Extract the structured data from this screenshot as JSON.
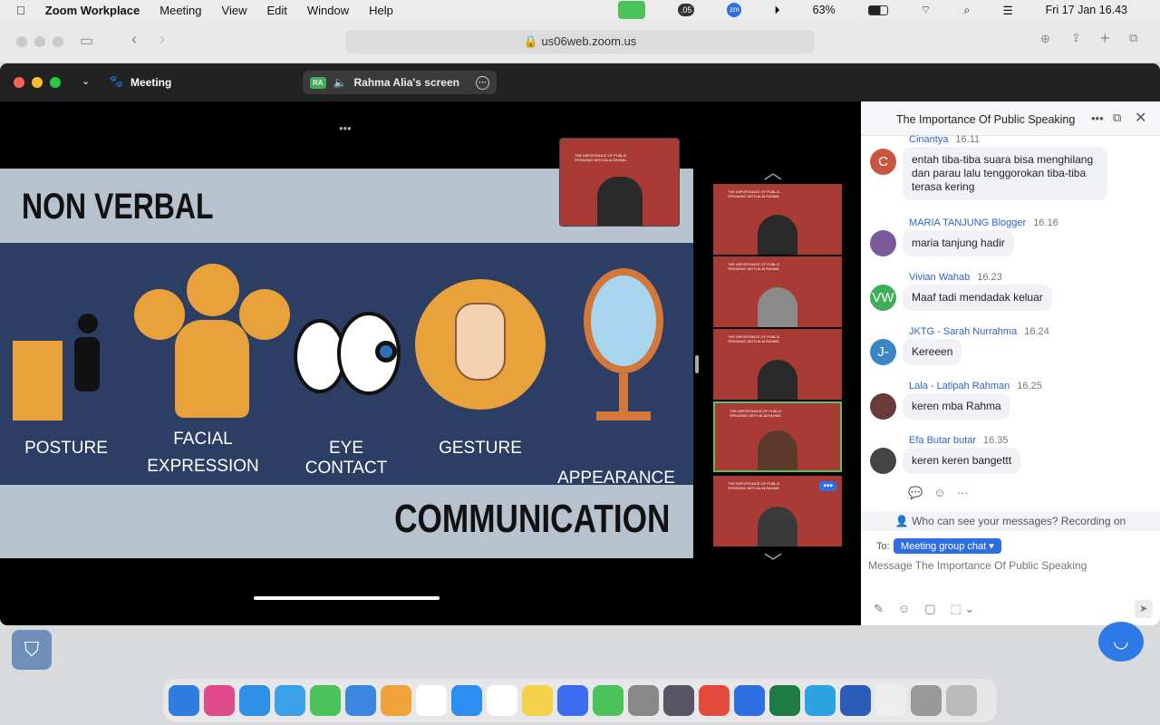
{
  "menubar": {
    "app": "Zoom Workplace",
    "items": [
      "Meeting",
      "View",
      "Edit",
      "Window",
      "Help"
    ],
    "battery": "63%",
    "datetime": "Fri 17 Jan  16.43",
    "badge": ".05"
  },
  "browser": {
    "url": "us06web.zoom.us"
  },
  "zoom": {
    "meeting_label": "Meeting",
    "share_initials": "RA",
    "share_label": "Rahma Alia's screen"
  },
  "slide": {
    "title": "NON VERBAL",
    "items": [
      "POSTURE",
      "FACIAL EXPRESSION",
      "EYE CONTACT",
      "GESTURE",
      "APPEARANCE"
    ],
    "footer": "COMMUNICATION",
    "thumb_text": "THE IMPORTANCE OF PUBLIC SPEAKING WITH ALIA RAHMA"
  },
  "chat": {
    "title": "The Importance Of Public Speaking",
    "messages": [
      {
        "name": "Cinantya",
        "time": "16.11",
        "text": "entah tiba-tiba suara bisa menghilang dan parau lalu tenggorokan tiba-tiba terasa kering",
        "initials": "C",
        "color": "#c9573f"
      },
      {
        "name": "MARIA TANJUNG Blogger",
        "time": "16.16",
        "text": "maria tanjung hadir",
        "initials": "",
        "color": "#7a5a9a"
      },
      {
        "name": "Vivian Wahab",
        "time": "16.23",
        "text": "Maaf tadi mendadak keluar",
        "initials": "VW",
        "color": "#3fae5a"
      },
      {
        "name": "JKTG - Sarah Nurrahma",
        "time": "16.24",
        "text": "Kereeen",
        "initials": "J-",
        "color": "#3b86c6"
      },
      {
        "name": "Lala - Latipah Rahman",
        "time": "16.25",
        "text": "keren mba Rahma",
        "initials": "",
        "color": "#6b3a3a"
      },
      {
        "name": "Efa Butar butar",
        "time": "16.35",
        "text": "keren keren bangettt",
        "initials": "",
        "color": "#444"
      }
    ],
    "privacy": "Who can see your messages? Recording on",
    "to_label": "To:",
    "recipient": "Meeting group chat",
    "placeholder": "Message The Importance Of Public Speaking"
  },
  "colors": {
    "accent": "#2d6fe0",
    "tile": "#a93a35",
    "slide_bg": "#2c3e63",
    "slide_band": "#b6c3ce",
    "icon_orange": "#e9a23b"
  }
}
